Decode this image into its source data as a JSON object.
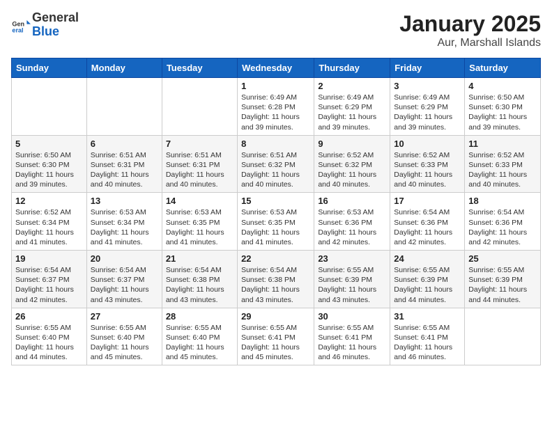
{
  "header": {
    "logo_general": "General",
    "logo_blue": "Blue",
    "title": "January 2025",
    "subtitle": "Aur, Marshall Islands"
  },
  "days_of_week": [
    "Sunday",
    "Monday",
    "Tuesday",
    "Wednesday",
    "Thursday",
    "Friday",
    "Saturday"
  ],
  "weeks": [
    [
      {
        "day": "",
        "info": ""
      },
      {
        "day": "",
        "info": ""
      },
      {
        "day": "",
        "info": ""
      },
      {
        "day": "1",
        "info": "Sunrise: 6:49 AM\nSunset: 6:28 PM\nDaylight: 11 hours and 39 minutes."
      },
      {
        "day": "2",
        "info": "Sunrise: 6:49 AM\nSunset: 6:29 PM\nDaylight: 11 hours and 39 minutes."
      },
      {
        "day": "3",
        "info": "Sunrise: 6:49 AM\nSunset: 6:29 PM\nDaylight: 11 hours and 39 minutes."
      },
      {
        "day": "4",
        "info": "Sunrise: 6:50 AM\nSunset: 6:30 PM\nDaylight: 11 hours and 39 minutes."
      }
    ],
    [
      {
        "day": "5",
        "info": "Sunrise: 6:50 AM\nSunset: 6:30 PM\nDaylight: 11 hours and 39 minutes."
      },
      {
        "day": "6",
        "info": "Sunrise: 6:51 AM\nSunset: 6:31 PM\nDaylight: 11 hours and 40 minutes."
      },
      {
        "day": "7",
        "info": "Sunrise: 6:51 AM\nSunset: 6:31 PM\nDaylight: 11 hours and 40 minutes."
      },
      {
        "day": "8",
        "info": "Sunrise: 6:51 AM\nSunset: 6:32 PM\nDaylight: 11 hours and 40 minutes."
      },
      {
        "day": "9",
        "info": "Sunrise: 6:52 AM\nSunset: 6:32 PM\nDaylight: 11 hours and 40 minutes."
      },
      {
        "day": "10",
        "info": "Sunrise: 6:52 AM\nSunset: 6:33 PM\nDaylight: 11 hours and 40 minutes."
      },
      {
        "day": "11",
        "info": "Sunrise: 6:52 AM\nSunset: 6:33 PM\nDaylight: 11 hours and 40 minutes."
      }
    ],
    [
      {
        "day": "12",
        "info": "Sunrise: 6:52 AM\nSunset: 6:34 PM\nDaylight: 11 hours and 41 minutes."
      },
      {
        "day": "13",
        "info": "Sunrise: 6:53 AM\nSunset: 6:34 PM\nDaylight: 11 hours and 41 minutes."
      },
      {
        "day": "14",
        "info": "Sunrise: 6:53 AM\nSunset: 6:35 PM\nDaylight: 11 hours and 41 minutes."
      },
      {
        "day": "15",
        "info": "Sunrise: 6:53 AM\nSunset: 6:35 PM\nDaylight: 11 hours and 41 minutes."
      },
      {
        "day": "16",
        "info": "Sunrise: 6:53 AM\nSunset: 6:36 PM\nDaylight: 11 hours and 42 minutes."
      },
      {
        "day": "17",
        "info": "Sunrise: 6:54 AM\nSunset: 6:36 PM\nDaylight: 11 hours and 42 minutes."
      },
      {
        "day": "18",
        "info": "Sunrise: 6:54 AM\nSunset: 6:36 PM\nDaylight: 11 hours and 42 minutes."
      }
    ],
    [
      {
        "day": "19",
        "info": "Sunrise: 6:54 AM\nSunset: 6:37 PM\nDaylight: 11 hours and 42 minutes."
      },
      {
        "day": "20",
        "info": "Sunrise: 6:54 AM\nSunset: 6:37 PM\nDaylight: 11 hours and 43 minutes."
      },
      {
        "day": "21",
        "info": "Sunrise: 6:54 AM\nSunset: 6:38 PM\nDaylight: 11 hours and 43 minutes."
      },
      {
        "day": "22",
        "info": "Sunrise: 6:54 AM\nSunset: 6:38 PM\nDaylight: 11 hours and 43 minutes."
      },
      {
        "day": "23",
        "info": "Sunrise: 6:55 AM\nSunset: 6:39 PM\nDaylight: 11 hours and 43 minutes."
      },
      {
        "day": "24",
        "info": "Sunrise: 6:55 AM\nSunset: 6:39 PM\nDaylight: 11 hours and 44 minutes."
      },
      {
        "day": "25",
        "info": "Sunrise: 6:55 AM\nSunset: 6:39 PM\nDaylight: 11 hours and 44 minutes."
      }
    ],
    [
      {
        "day": "26",
        "info": "Sunrise: 6:55 AM\nSunset: 6:40 PM\nDaylight: 11 hours and 44 minutes."
      },
      {
        "day": "27",
        "info": "Sunrise: 6:55 AM\nSunset: 6:40 PM\nDaylight: 11 hours and 45 minutes."
      },
      {
        "day": "28",
        "info": "Sunrise: 6:55 AM\nSunset: 6:40 PM\nDaylight: 11 hours and 45 minutes."
      },
      {
        "day": "29",
        "info": "Sunrise: 6:55 AM\nSunset: 6:41 PM\nDaylight: 11 hours and 45 minutes."
      },
      {
        "day": "30",
        "info": "Sunrise: 6:55 AM\nSunset: 6:41 PM\nDaylight: 11 hours and 46 minutes."
      },
      {
        "day": "31",
        "info": "Sunrise: 6:55 AM\nSunset: 6:41 PM\nDaylight: 11 hours and 46 minutes."
      },
      {
        "day": "",
        "info": ""
      }
    ]
  ]
}
